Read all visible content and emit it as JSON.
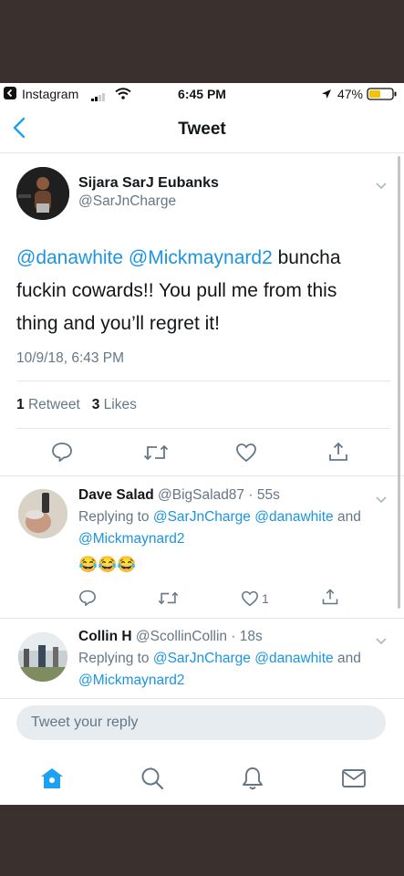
{
  "status_bar": {
    "back_app": "Instagram",
    "time": "6:45 PM",
    "battery": "47%"
  },
  "nav": {
    "title": "Tweet"
  },
  "tweet": {
    "display_name": "Sijara SarJ Eubanks",
    "handle": "@SarJnCharge",
    "mention1": "@danawhite",
    "mention2": "@Mickmaynard2",
    "text_after_mentions": " buncha fuckin cowards!! You pull me from this thing and you’ll regret it!",
    "timestamp": "10/9/18, 6:43 PM",
    "retweets_count": "1",
    "retweets_label": "Retweet",
    "likes_count": "3",
    "likes_label": "Likes"
  },
  "replies": [
    {
      "name": "Dave Salad",
      "handle_time": "@BigSalad87 · 55s",
      "replying_prefix": "Replying to ",
      "replying_to1": "@SarJnCharge",
      "replying_to2": "@danawhite",
      "replying_and": "and",
      "replying_to3": "@Mickmaynard2",
      "text": "😂😂😂",
      "like_count": "1"
    },
    {
      "name": "Collin H",
      "handle_time": "@ScollinCollin · 18s",
      "replying_prefix": "Replying to ",
      "replying_to1": "@SarJnCharge",
      "replying_to2": "@danawhite",
      "replying_and": "and",
      "replying_to3": "@Mickmaynard2"
    }
  ],
  "reply_box": {
    "placeholder": "Tweet your reply"
  },
  "tabbar": {
    "items": [
      {
        "icon": "home-icon",
        "active": true
      },
      {
        "icon": "search-icon",
        "active": false
      },
      {
        "icon": "bell-icon",
        "active": false
      },
      {
        "icon": "mail-icon",
        "active": false
      }
    ]
  },
  "colors": {
    "accent": "#1da1f2",
    "link": "#1b95e0",
    "muted": "#657786",
    "border": "#e1e8ed",
    "backdrop": "#3a312f"
  }
}
